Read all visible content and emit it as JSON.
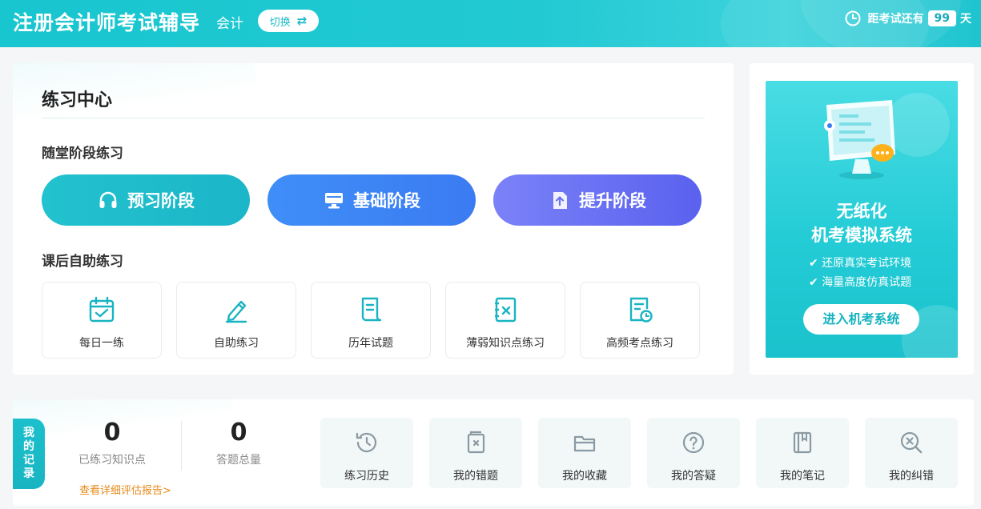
{
  "header": {
    "brand": "注册会计师考试辅导",
    "subject": "会计",
    "switch_label": "切换",
    "countdown_prefix": "距考试还有",
    "countdown_days": "99",
    "countdown_suffix": "天"
  },
  "practice": {
    "title": "练习中心",
    "section_stage": "随堂阶段练习",
    "stages": [
      {
        "label": "预习阶段",
        "icon": "headphones-icon"
      },
      {
        "label": "基础阶段",
        "icon": "desktop-icon"
      },
      {
        "label": "提升阶段",
        "icon": "upload-doc-icon"
      }
    ],
    "section_self": "课后自助练习",
    "cards": [
      {
        "label": "每日一练",
        "icon": "calendar-check-icon"
      },
      {
        "label": "自助练习",
        "icon": "pencil-icon"
      },
      {
        "label": "历年试题",
        "icon": "scroll-icon"
      },
      {
        "label": "薄弱知识点练习",
        "icon": "notebook-x-icon"
      },
      {
        "label": "高频考点练习",
        "icon": "doc-clock-icon"
      }
    ]
  },
  "promo": {
    "title_line1": "无纸化",
    "title_line2": "机考模拟系统",
    "features": [
      "还原真实考试环境",
      "海量高度仿真试题"
    ],
    "button": "进入机考系统"
  },
  "records": {
    "tag": [
      "我",
      "的",
      "记",
      "录"
    ],
    "stats": [
      {
        "value": "0",
        "caption": "已练习知识点"
      },
      {
        "value": "0",
        "caption": "答题总量"
      }
    ],
    "report_link": "查看详细评估报告>",
    "items": [
      {
        "label": "练习历史",
        "icon": "history-icon"
      },
      {
        "label": "我的错题",
        "icon": "wrong-book-icon"
      },
      {
        "label": "我的收藏",
        "icon": "folder-icon"
      },
      {
        "label": "我的答疑",
        "icon": "question-icon"
      },
      {
        "label": "我的笔记",
        "icon": "notes-icon"
      },
      {
        "label": "我的纠错",
        "icon": "search-x-icon"
      }
    ]
  },
  "colors": {
    "brand": "#1fc4cf",
    "accent_blue": "#3b7bf2",
    "accent_purple": "#5a61ee",
    "link_orange": "#e78b1a",
    "icon_teal": "#19b4c2",
    "icon_gray": "#8a9aa3"
  }
}
